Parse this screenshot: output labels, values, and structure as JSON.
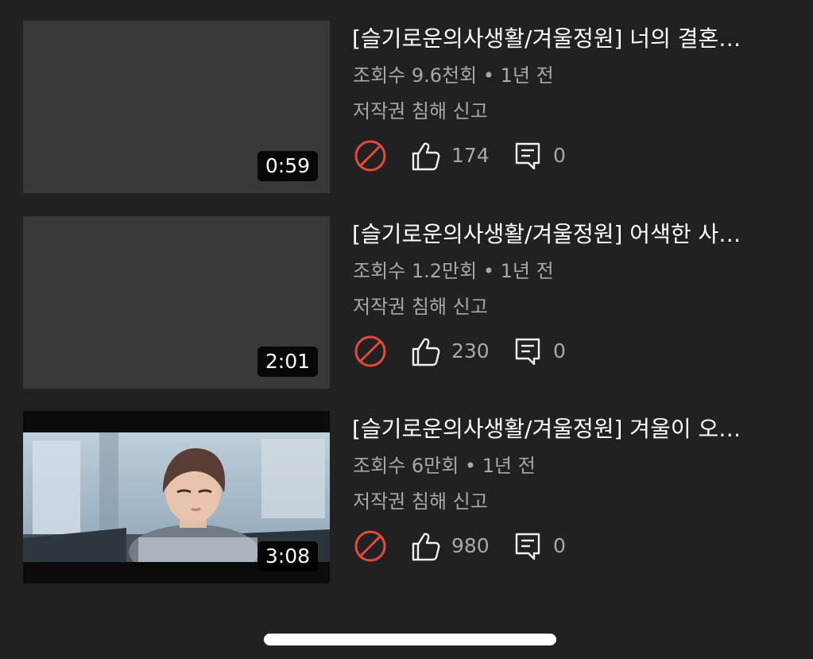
{
  "videos": [
    {
      "title": "[슬기로운의사생활/겨울정원] 너의 결혼…",
      "meta": "조회수 9.6천회 • 1년 전",
      "report": "저작권 침해 신고",
      "duration": "0:59",
      "likes": "174",
      "comments": "0",
      "thumbnail": "empty"
    },
    {
      "title": "[슬기로운의사생활/겨울정원] 어색한 사…",
      "meta": "조회수 1.2만회 • 1년 전",
      "report": "저작권 침해 신고",
      "duration": "2:01",
      "likes": "230",
      "comments": "0",
      "thumbnail": "empty"
    },
    {
      "title": "[슬기로운의사생활/겨울정원] 겨울이 오…",
      "meta": "조회수 6만회 • 1년 전",
      "report": "저작권 침해 신고",
      "duration": "3:08",
      "likes": "980",
      "comments": "0",
      "thumbnail": "scene"
    }
  ],
  "icons": {
    "blocked": "blocked-icon",
    "like": "thumb-up-icon",
    "comment": "comment-icon"
  },
  "colors": {
    "background": "#212121",
    "thumbnail_placeholder": "#383838",
    "secondary_text": "#a8a8a8",
    "blocked_red": "#e5483f"
  }
}
